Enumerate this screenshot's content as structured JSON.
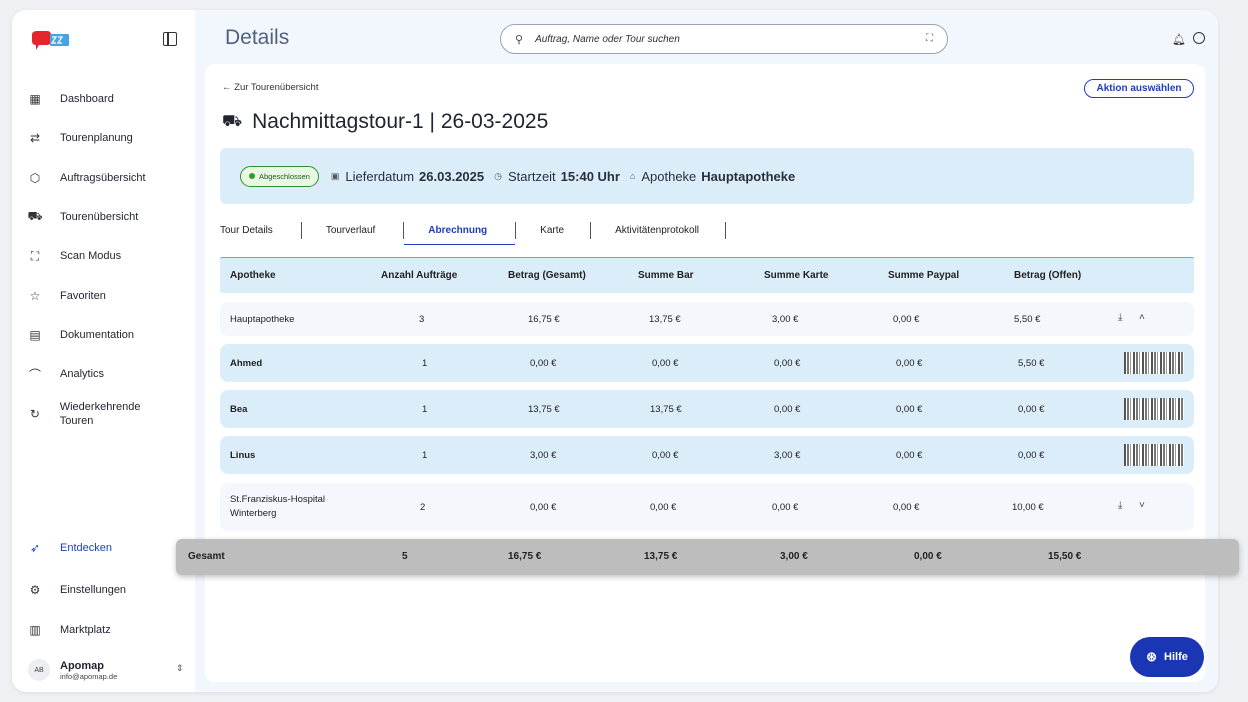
{
  "sidebar": {
    "items": [
      {
        "label": "Dashboard",
        "icon": "grid-icon"
      },
      {
        "label": "Tourenplanung",
        "icon": "route-icon"
      },
      {
        "label": "Auftragsübersicht",
        "icon": "box-icon"
      },
      {
        "label": "Tourenübersicht",
        "icon": "car-icon"
      },
      {
        "label": "Scan Modus",
        "icon": "scan-icon"
      },
      {
        "label": "Favoriten",
        "icon": "star-icon"
      },
      {
        "label": "Dokumentation",
        "icon": "document-search-icon"
      },
      {
        "label": "Analytics",
        "icon": "chart-line-icon"
      },
      {
        "label": "Wiederkehrende Touren",
        "icon": "refresh-icon"
      }
    ],
    "bottom_items": [
      {
        "label": "Entdecken",
        "icon": "rocket-icon"
      },
      {
        "label": "Einstellungen",
        "icon": "gear-icon"
      },
      {
        "label": "Marktplatz",
        "icon": "store-icon"
      }
    ],
    "user": {
      "initials": "AB",
      "name": "Apomap",
      "email": "info@apomap.de"
    }
  },
  "header": {
    "title": "Details",
    "search_placeholder": "Auftrag, Name oder Tour suchen"
  },
  "detail": {
    "back_label": "← Zur Tourenübersicht",
    "action_label": "Aktion auswählen",
    "tour_title": "Nachmittagstour-1 | 26-03-2025",
    "status_badge": "Abgeschlossen",
    "lieferdatum_label": "Lieferdatum",
    "lieferdatum_value": "26.03.2025",
    "startzeit_label": "Startzeit",
    "startzeit_value": "15:40 Uhr",
    "apotheke_label": "Apotheke",
    "apotheke_value": "Hauptapotheke"
  },
  "tabs": [
    "Tour Details",
    "Tourverlauf",
    "Abrechnung",
    "Karte",
    "Aktivitätenprotokoll"
  ],
  "table": {
    "headers": [
      "Apotheke",
      "Anzahl Aufträge",
      "Betrag (Gesamt)",
      "Summe Bar",
      "Summe Karte",
      "Summe Paypal",
      "Betrag (Offen)"
    ],
    "rows": [
      {
        "name": "Hauptapotheke",
        "count": "3",
        "total": "16,75 €",
        "bar": "13,75 €",
        "karte": "3,00 €",
        "paypal": "0,00 €",
        "offen": "5,50 €"
      },
      {
        "name": "Ahmed",
        "count": "1",
        "total": "0,00 €",
        "bar": "0,00 €",
        "karte": "0,00 €",
        "paypal": "0,00 €",
        "offen": "5,50 €"
      },
      {
        "name": "Bea",
        "count": "1",
        "total": "13,75 €",
        "bar": "13,75 €",
        "karte": "0,00 €",
        "paypal": "0,00 €",
        "offen": "0,00 €"
      },
      {
        "name": "Linus",
        "count": "1",
        "total": "3,00 €",
        "bar": "0,00 €",
        "karte": "3,00 €",
        "paypal": "0,00 €",
        "offen": "0,00 €"
      },
      {
        "name": "St.Franziskus-Hospital Winterberg",
        "count": "2",
        "total": "0,00 €",
        "bar": "0,00 €",
        "karte": "0,00 €",
        "paypal": "0,00 €",
        "offen": "10,00 €"
      }
    ],
    "total": {
      "label": "Gesamt",
      "count": "5",
      "total": "16,75 €",
      "bar": "13,75 €",
      "karte": "3,00 €",
      "paypal": "0,00 €",
      "offen": "15,50 €"
    }
  },
  "help_label": "Hilfe"
}
